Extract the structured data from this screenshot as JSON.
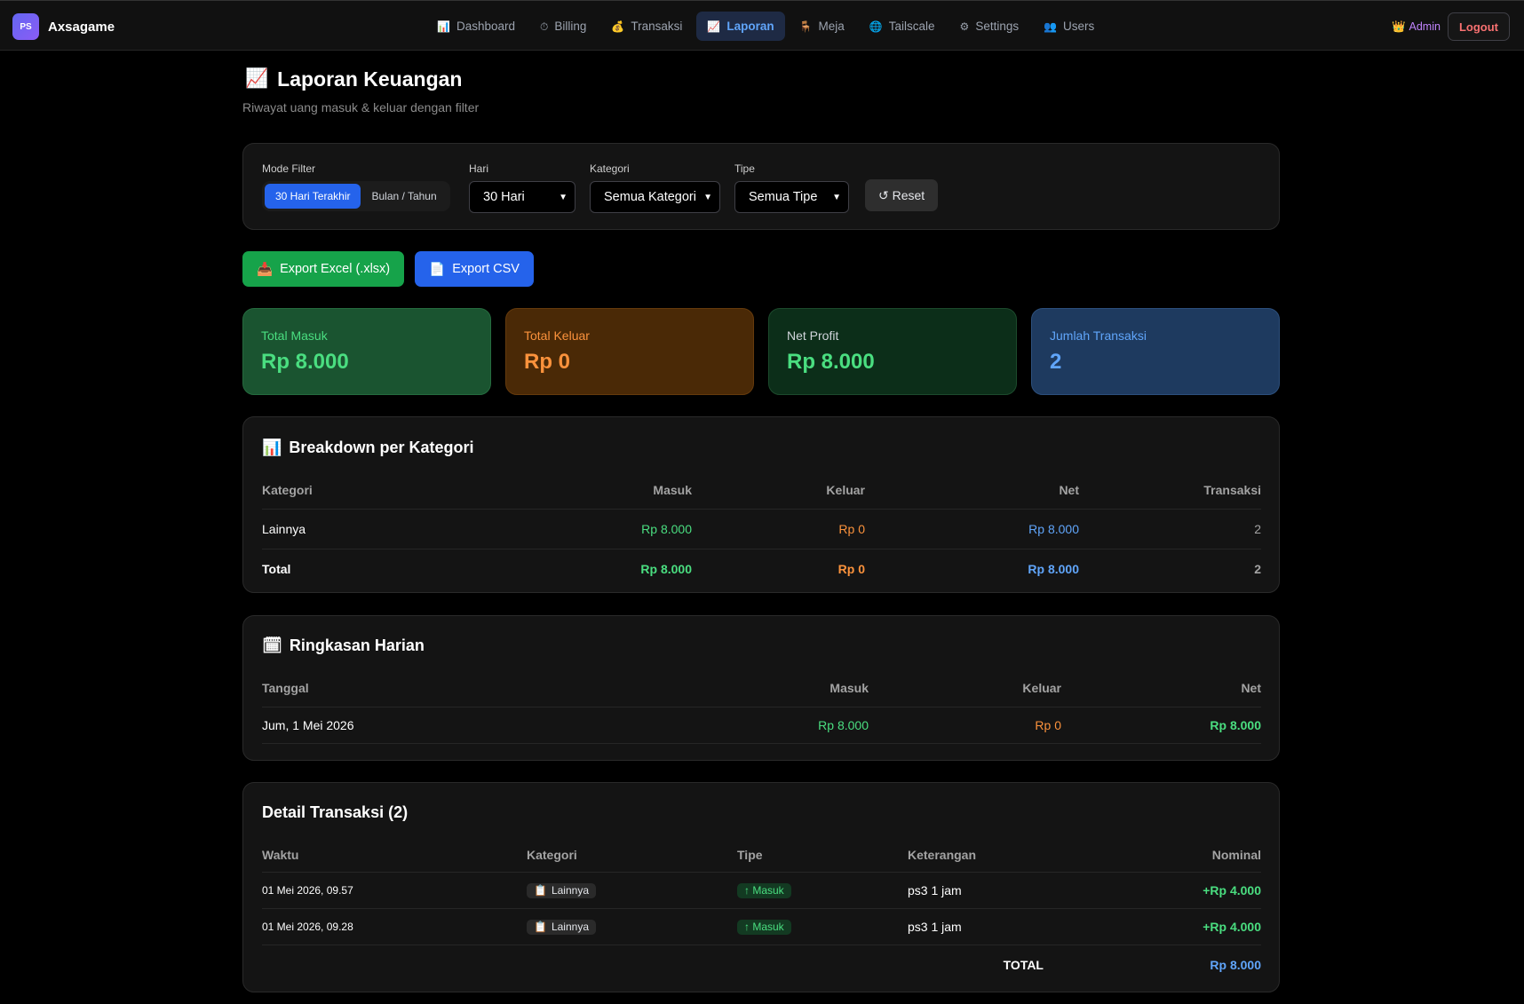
{
  "app": {
    "brand_logo": "PS",
    "brand_name": "Axsagame"
  },
  "nav": [
    {
      "label": "Dashboard",
      "icon": "📊",
      "active": false
    },
    {
      "label": "Billing",
      "icon": "⏱",
      "active": false
    },
    {
      "label": "Transaksi",
      "icon": "💰",
      "active": false
    },
    {
      "label": "Laporan",
      "icon": "📈",
      "active": true
    },
    {
      "label": "Meja",
      "icon": "🪑",
      "active": false
    },
    {
      "label": "Tailscale",
      "icon": "🌐",
      "active": false
    },
    {
      "label": "Settings",
      "icon": "⚙",
      "active": false
    },
    {
      "label": "Users",
      "icon": "👥",
      "active": false
    }
  ],
  "user": {
    "role_icon": "👑",
    "role": "Admin",
    "logout": "Logout"
  },
  "page": {
    "icon": "📈",
    "title": "Laporan Keuangan",
    "subtitle": "Riwayat uang masuk & keluar dengan filter"
  },
  "filters": {
    "mode_label": "Mode Filter",
    "mode_options": [
      "30 Hari Terakhir",
      "Bulan / Tahun"
    ],
    "days_label": "Hari",
    "days_value": "30 Hari",
    "category_label": "Kategori",
    "category_value": "Semua Kategori",
    "type_label": "Tipe",
    "type_value": "Semua Tipe",
    "reset": "↺ Reset"
  },
  "exports": {
    "excel_icon": "📥",
    "excel": "Export Excel (.xlsx)",
    "csv_icon": "📄",
    "csv": "Export CSV"
  },
  "stats": {
    "total_in_label": "Total Masuk",
    "total_in": "Rp 8.000",
    "total_out_label": "Total Keluar",
    "total_out": "Rp 0",
    "net_label": "Net Profit",
    "net": "Rp 8.000",
    "count_label": "Jumlah Transaksi",
    "count": "2"
  },
  "breakdown": {
    "icon": "📊",
    "title": "Breakdown per Kategori",
    "headers": {
      "category": "Kategori",
      "in": "Masuk",
      "out": "Keluar",
      "net": "Net",
      "count": "Transaksi"
    },
    "rows": [
      {
        "category": "Lainnya",
        "in": "Rp 8.000",
        "out": "Rp 0",
        "net": "Rp 8.000",
        "count": "2"
      }
    ],
    "total": {
      "category": "Total",
      "in": "Rp 8.000",
      "out": "Rp 0",
      "net": "Rp 8.000",
      "count": "2"
    }
  },
  "daily": {
    "icon": "🗓",
    "title": "Ringkasan Harian",
    "headers": {
      "date": "Tanggal",
      "in": "Masuk",
      "out": "Keluar",
      "net": "Net"
    },
    "rows": [
      {
        "date": "Jum, 1 Mei 2026",
        "in": "Rp 8.000",
        "out": "Rp 0",
        "net": "Rp 8.000"
      }
    ]
  },
  "details": {
    "title": "Detail Transaksi (2)",
    "headers": {
      "time": "Waktu",
      "category": "Kategori",
      "type": "Tipe",
      "note": "Keterangan",
      "amount": "Nominal"
    },
    "rows": [
      {
        "time": "01 Mei 2026, 09.57",
        "category": "Lainnya",
        "category_icon": "📋",
        "type": "↑ Masuk",
        "note": "ps3 1 jam",
        "amount": "+Rp 4.000"
      },
      {
        "time": "01 Mei 2026, 09.28",
        "category": "Lainnya",
        "category_icon": "📋",
        "type": "↑ Masuk",
        "note": "ps3 1 jam",
        "amount": "+Rp 4.000"
      }
    ],
    "total_label": "TOTAL",
    "total": "Rp 8.000"
  }
}
